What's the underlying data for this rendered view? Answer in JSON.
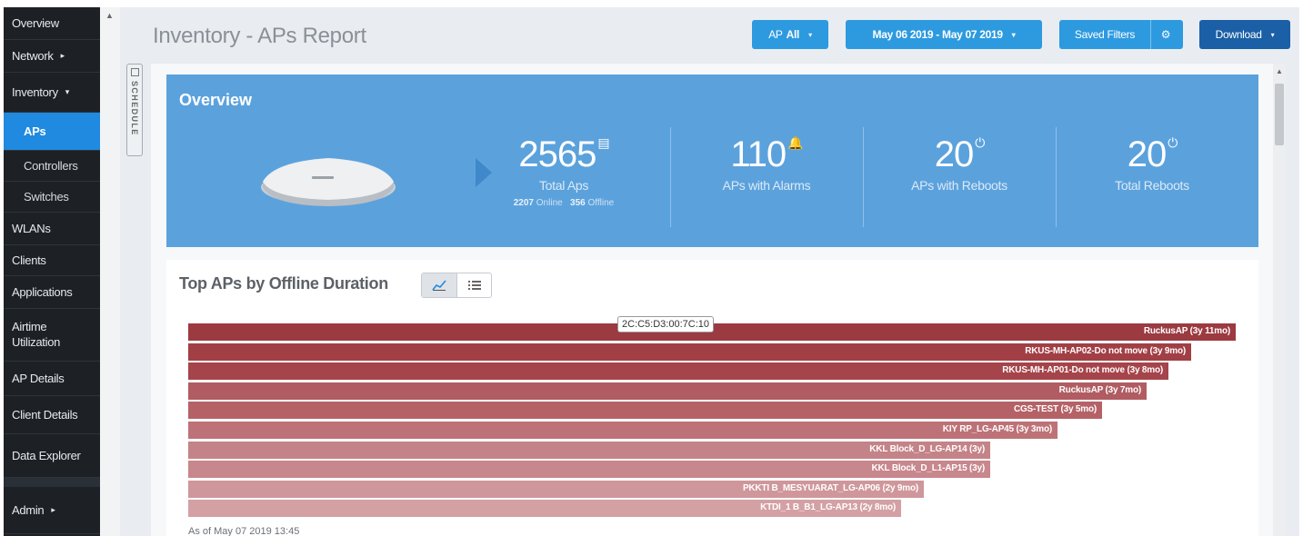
{
  "sidebar": {
    "items": [
      {
        "label": "Overview",
        "type": "top"
      },
      {
        "label": "Network",
        "type": "top",
        "arrow": "▸"
      },
      {
        "label": "Inventory",
        "type": "top",
        "arrow": "▾"
      },
      {
        "label": "APs",
        "type": "active"
      },
      {
        "label": "Controllers",
        "type": "sub"
      },
      {
        "label": "Switches",
        "type": "sub"
      },
      {
        "label": "WLANs",
        "type": "top"
      },
      {
        "label": "Clients",
        "type": "top"
      },
      {
        "label": "Applications",
        "type": "top"
      },
      {
        "label": "Airtime\nUtilization",
        "type": "top"
      },
      {
        "label": "AP Details",
        "type": "top"
      },
      {
        "label": "Client Details",
        "type": "top"
      },
      {
        "label": "Data Explorer",
        "type": "top"
      },
      {
        "label": "Admin",
        "type": "top",
        "arrow": "▸"
      }
    ],
    "collapse_icon": "▲"
  },
  "schedule_tab": {
    "label": "SCHEDULE"
  },
  "header": {
    "title": "Inventory - APs Report",
    "ap_filter": {
      "prefix": "AP",
      "value": "All",
      "caret": "▾"
    },
    "date_range": {
      "label": "May 06 2019 - May 07 2019",
      "caret": "▾"
    },
    "saved_filters": {
      "label": "Saved Filters",
      "gear": "⚙"
    },
    "download": {
      "label": "Download",
      "caret": "▾"
    }
  },
  "overview": {
    "title": "Overview",
    "stats": [
      {
        "value": "2565",
        "label": "Total Aps",
        "online_count": "2207",
        "online_label": "Online",
        "offline_count": "356",
        "offline_label": "Offline"
      },
      {
        "value": "110",
        "label": "APs with Alarms"
      },
      {
        "value": "20",
        "label": "APs with Reboots"
      },
      {
        "value": "20",
        "label": "Total Reboots"
      }
    ]
  },
  "chart": {
    "title": "Top APs by Offline Duration",
    "tooltip": "2C:C5:D3:00:7C:10",
    "as_of": "As of May 07 2019 13:45",
    "view_toggle": {
      "chart_icon": "📈",
      "table_icon": "☰"
    }
  },
  "chart_data": {
    "type": "bar",
    "orientation": "horizontal",
    "unit": "months",
    "categories": [
      "RuckusAP (3y 11mo)",
      "RKUS-MH-AP02-Do not move (3y 9mo)",
      "RKUS-MH-AP01-Do not move (3y 8mo)",
      "RuckusAP (3y 7mo)",
      "CGS-TEST (3y 5mo)",
      "KIY RP_LG-AP45 (3y 3mo)",
      "KKL Block_D_LG-AP14 (3y)",
      "KKL Block_D_L1-AP15 (3y)",
      "PKKTI B_MESYUARAT_LG-AP06 (2y 9mo)",
      "KTDI_1 B_B1_LG-AP13 (2y 8mo)"
    ],
    "values": [
      47,
      45,
      44,
      43,
      41,
      39,
      36,
      36,
      33,
      32
    ],
    "colors": [
      "#9b3a40",
      "#a13f45",
      "#a5444a",
      "#b05c62",
      "#b56267",
      "#bd7277",
      "#c48388",
      "#c7878c",
      "#cf979b",
      "#d3a0a4"
    ]
  }
}
